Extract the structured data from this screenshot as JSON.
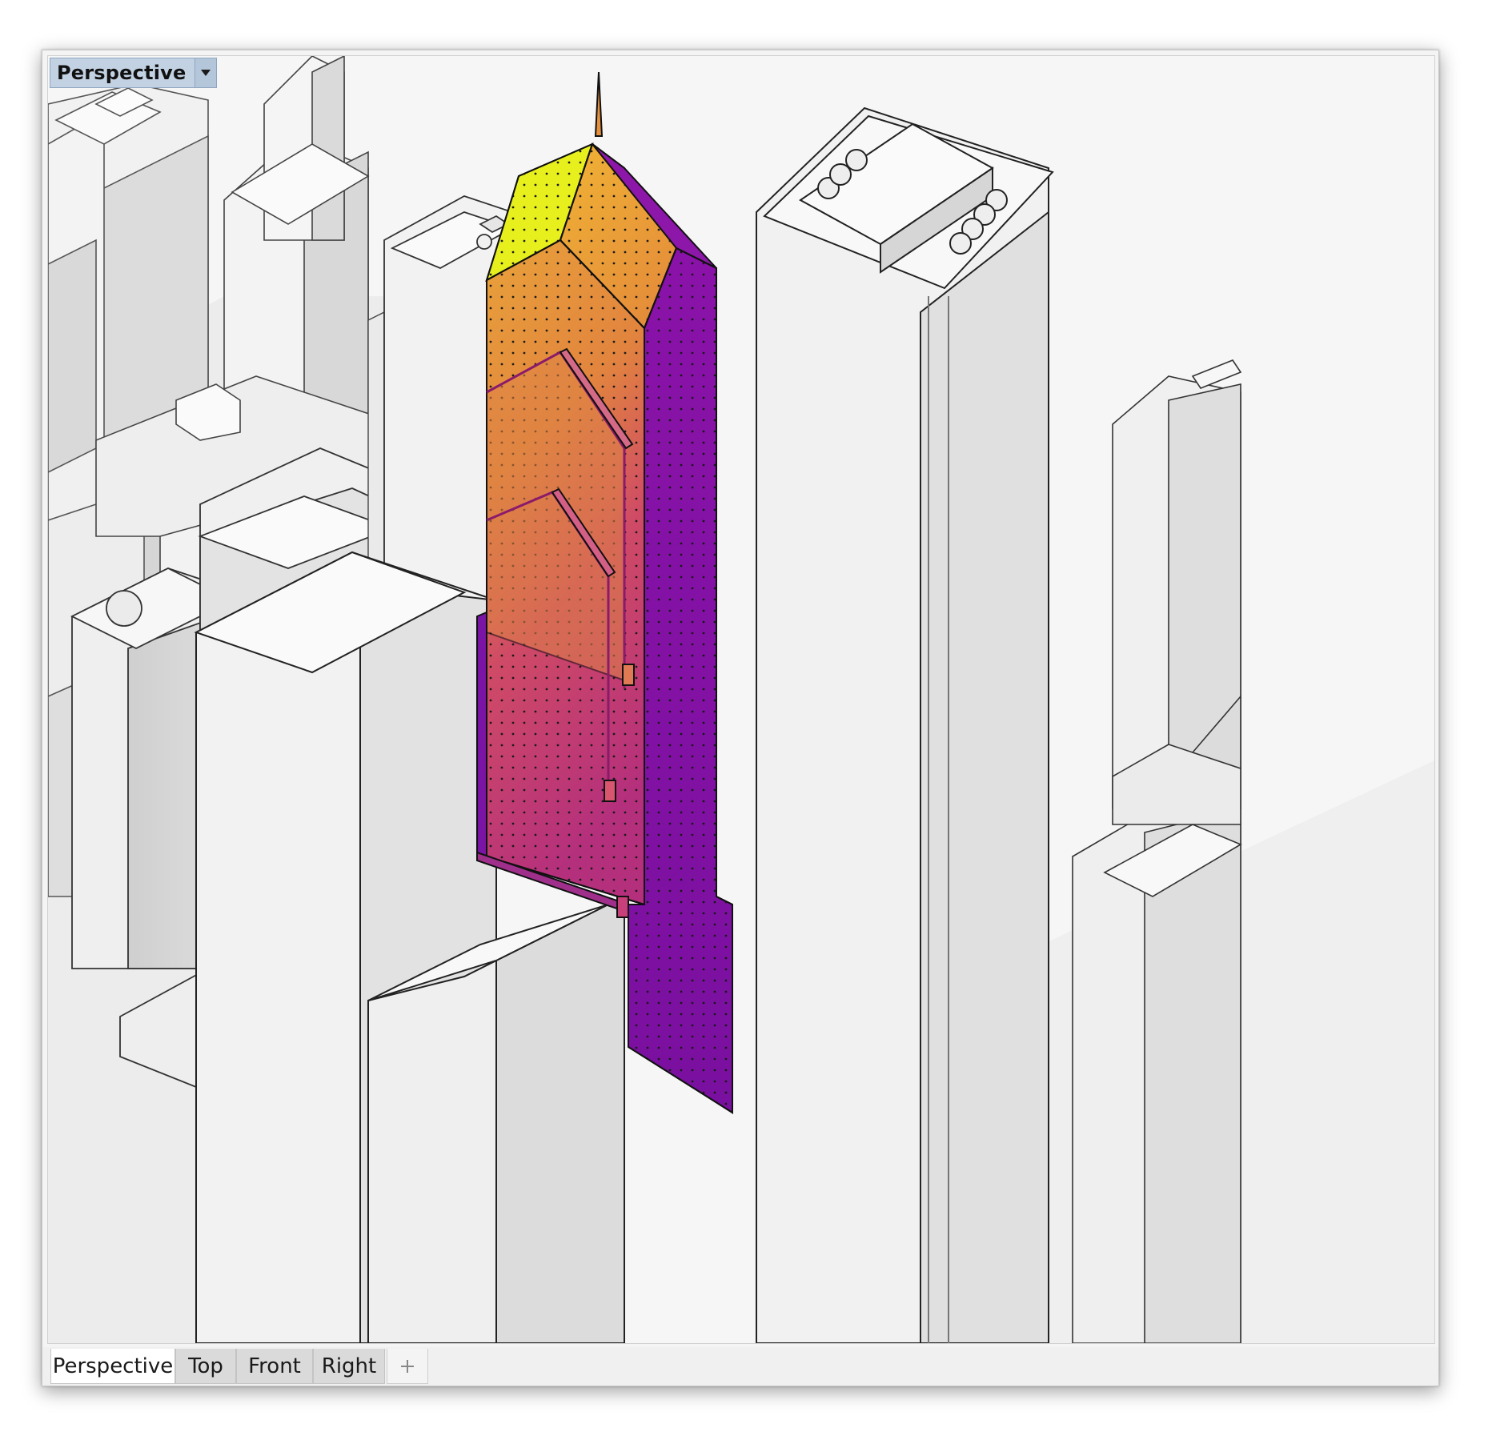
{
  "viewport": {
    "label": "Perspective",
    "dropdown_icon": "caret-down-icon"
  },
  "tabs": [
    {
      "label": "Perspective",
      "active": true
    },
    {
      "label": "Top",
      "active": false
    },
    {
      "label": "Front",
      "active": false
    },
    {
      "label": "Right",
      "active": false
    }
  ],
  "add_tab_icon": "plus-icon",
  "colors": {
    "analysis_hot": "#e6f019",
    "analysis_mid": "#e8903a",
    "analysis_warm": "#c9406e",
    "analysis_cold": "#7d0fa8",
    "building_light": "#f2f2f2",
    "building_shade": "#d8d8d8",
    "label_bg": "#c3d2e3"
  }
}
